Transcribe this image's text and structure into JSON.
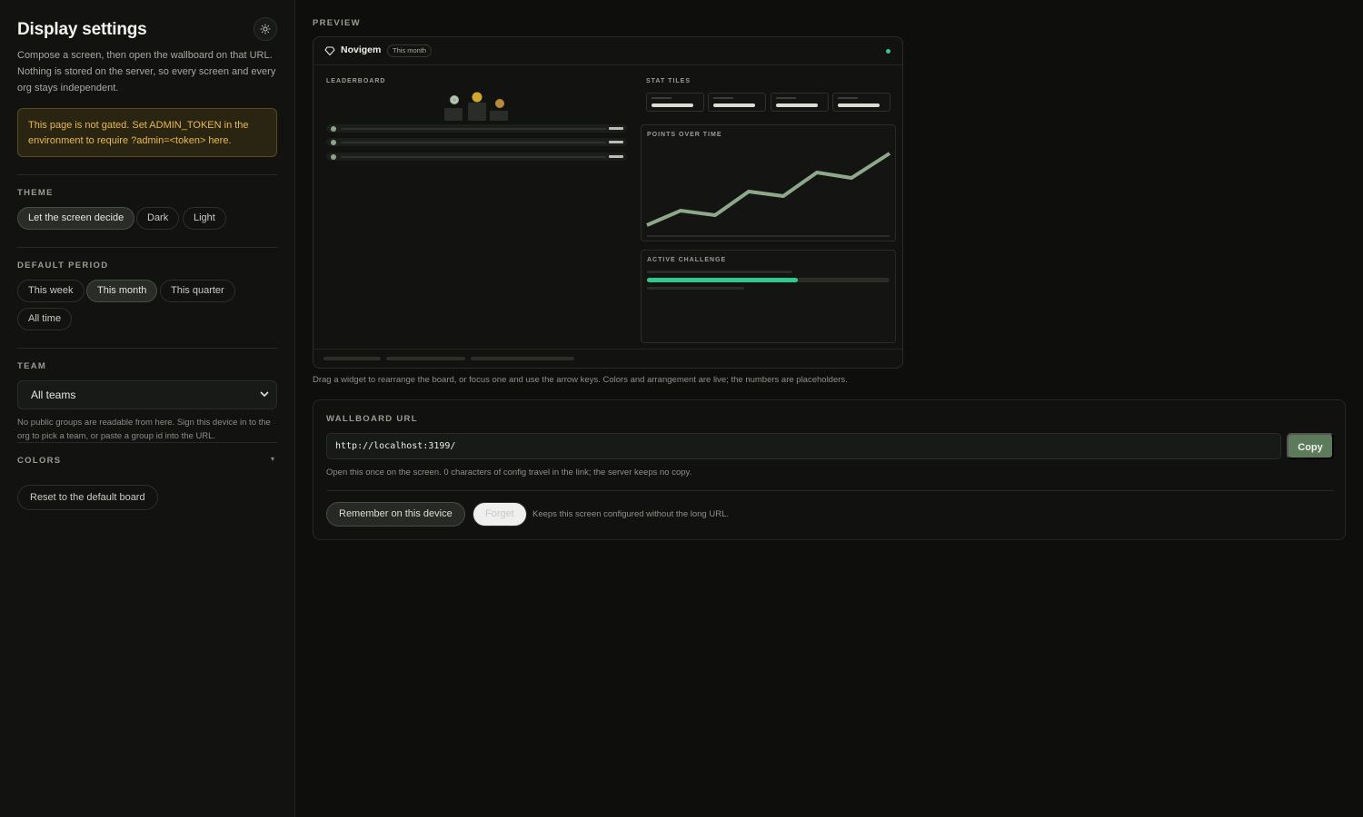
{
  "sidebar": {
    "title": "Display settings",
    "intro": "Compose a screen, then open the wallboard on that URL. Nothing is stored on the server, so every screen and every org stays independent.",
    "warning": "This page is not gated. Set ADMIN_TOKEN in the environment to require ?admin=<token> here.",
    "theme": {
      "label": "THEME",
      "options": [
        "Let the screen decide",
        "Dark",
        "Light"
      ],
      "selected": "Let the screen decide"
    },
    "period": {
      "label": "DEFAULT PERIOD",
      "options": [
        "This week",
        "This month",
        "This quarter",
        "All time"
      ],
      "selected": "This month"
    },
    "team": {
      "label": "TEAM",
      "selected": "All teams",
      "hint": "No public groups are readable from here. Sign this device in to the org to pick a team, or paste a group id into the URL."
    },
    "colors": {
      "label": "COLORS"
    },
    "reset_label": "Reset to the default board",
    "icons": {
      "theme": "sun-icon",
      "colors_toggle": "caret-down-icon",
      "select": "chevron-down-icon"
    }
  },
  "preview": {
    "label": "PREVIEW",
    "brand": "Novigem",
    "period_badge": "This month",
    "status_color": "#2fc98d",
    "widgets": {
      "leaderboard": "LEADERBOARD",
      "stat_tiles": "STAT TILES",
      "points_over_time": "POINTS OVER TIME",
      "active_challenge": "ACTIVE CHALLENGE"
    },
    "challenge_progress": 0.62,
    "hint": "Drag a widget to rearrange the board, or focus one and use the arrow keys. Colors and arrangement are live; the numbers are placeholders."
  },
  "wallboard": {
    "label": "WALLBOARD URL",
    "url": "http://localhost:3199/",
    "copy_label": "Copy",
    "note": "Open this once on the screen. 0 characters of config travel in the link; the server keeps no copy.",
    "remember_label": "Remember on this device",
    "forget_label": "Forget",
    "keep_note": "Keeps this screen configured without the long URL."
  },
  "colors": {
    "accent": "#5d7a5a",
    "warning_text": "#e9b949",
    "line": "#8ea88a",
    "progress": "#2fc98d"
  }
}
